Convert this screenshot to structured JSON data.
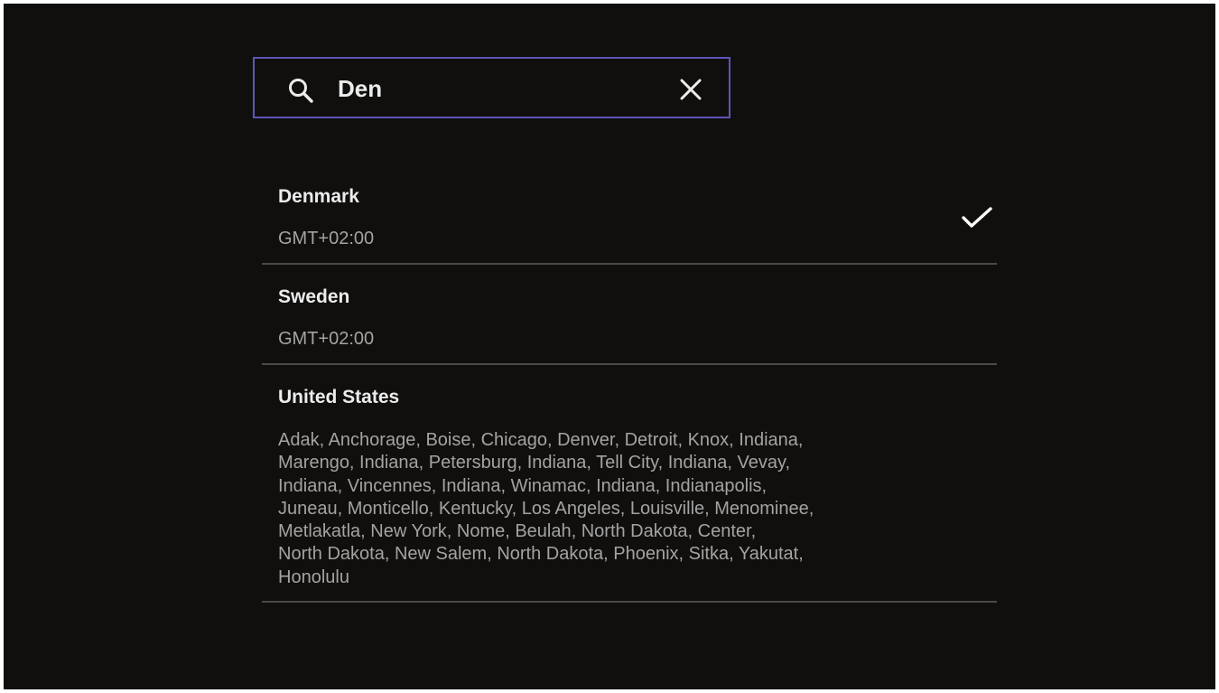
{
  "search": {
    "value": "Den",
    "icon": "search-icon",
    "clear_icon": "close-icon",
    "border_color": "#5b56b8"
  },
  "results": [
    {
      "name": "Denmark",
      "subtitle": "GMT+02:00",
      "selected": true,
      "selected_icon": "checkmark-icon"
    },
    {
      "name": "Sweden",
      "subtitle": "GMT+02:00",
      "selected": false
    },
    {
      "name": "United States",
      "lines": [
        "Adak, Anchorage, Boise, Chicago, Denver, Detroit, Knox, Indiana,",
        "Marengo, Indiana, Petersburg, Indiana, Tell City, Indiana, Vevay,",
        "Indiana, Vincennes, Indiana, Winamac, Indiana, Indianapolis,",
        "Juneau, Monticello, Kentucky, Los Angeles, Louisville, Menominee,",
        "Metlakatla, New York, Nome, Beulah, North Dakota, Center,",
        "North Dakota, New Salem, North Dakota, Phoenix, Sitka, Yakutat,",
        "Honolulu"
      ],
      "selected": false
    }
  ],
  "colors": {
    "background": "#110f0d",
    "primary_text": "#ececec",
    "secondary_text": "#a3a3a3",
    "divider": "#4b4a48"
  }
}
